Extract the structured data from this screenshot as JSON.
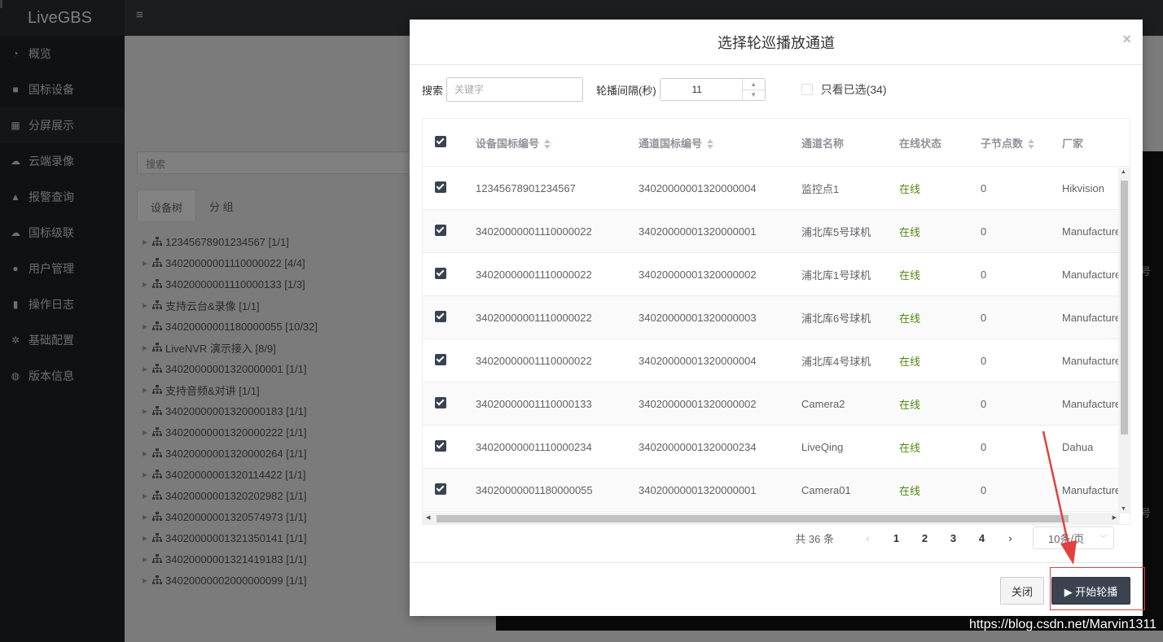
{
  "app": {
    "title": "LiveGBS"
  },
  "sidebar": {
    "items": [
      {
        "label": "概览",
        "icon": "dashboard-icon"
      },
      {
        "label": "国标设备",
        "icon": "video-camera-icon"
      },
      {
        "label": "分屏展示",
        "icon": "grid-icon"
      },
      {
        "label": "云端录像",
        "icon": "cloud-icon"
      },
      {
        "label": "报警查询",
        "icon": "bell-icon"
      },
      {
        "label": "国标级联",
        "icon": "cloud-upload-icon"
      },
      {
        "label": "用户管理",
        "icon": "users-icon"
      },
      {
        "label": "操作日志",
        "icon": "file-icon"
      },
      {
        "label": "基础配置",
        "icon": "gears-icon"
      },
      {
        "label": "版本信息",
        "icon": "globe-icon"
      }
    ]
  },
  "background": {
    "search_placeholder": "搜索",
    "tabs": [
      "设备树",
      "分 组"
    ],
    "tree": [
      "12345678901234567 [1/1]",
      "34020000001110000022 [4/4]",
      "34020000001110000133 [1/3]",
      "支持云台&录像 [1/1]",
      "34020000001180000055 [10/32]",
      "LiveNVR 演示接入 [8/9]",
      "34020000001320000001 [1/1]",
      "支持音频&对讲 [1/1]",
      "34020000001320000183 [1/1]",
      "34020000001320000222 [1/1]",
      "34020000001320000264 [1/1]",
      "34020000001320114422 [1/1]",
      "34020000001320202982 [1/1]",
      "34020000001320574973 [1/1]",
      "34020000001321350141 [1/1]",
      "34020000001321419183 [1/1]",
      "34020000002000000099 [1/1]"
    ],
    "side_label": "号"
  },
  "modal": {
    "title": "选择轮巡播放通道",
    "close_glyph": "×",
    "search_label": "搜索",
    "search_placeholder": "关键字",
    "interval_label": "轮播间隔(秒)",
    "interval_value": "11",
    "only_selected_label": "只看已选(34)",
    "columns": [
      "设备国标编号",
      "通道国标编号",
      "通道名称",
      "在线状态",
      "子节点数",
      "厂家"
    ],
    "rows": [
      {
        "device": "12345678901234567",
        "channel": "34020000001320000004",
        "name": "监控点1",
        "status": "在线",
        "children": "0",
        "vendor": "Hikvision"
      },
      {
        "device": "34020000001110000022",
        "channel": "34020000001320000001",
        "name": "浦北库5号球机",
        "status": "在线",
        "children": "0",
        "vendor": "Manufacturer"
      },
      {
        "device": "34020000001110000022",
        "channel": "34020000001320000002",
        "name": "浦北库1号球机",
        "status": "在线",
        "children": "0",
        "vendor": "Manufacturer"
      },
      {
        "device": "34020000001110000022",
        "channel": "34020000001320000003",
        "name": "浦北库6号球机",
        "status": "在线",
        "children": "0",
        "vendor": "Manufacturer"
      },
      {
        "device": "34020000001110000022",
        "channel": "34020000001320000004",
        "name": "浦北库4号球机",
        "status": "在线",
        "children": "0",
        "vendor": "Manufacturer"
      },
      {
        "device": "34020000001110000133",
        "channel": "34020000001320000002",
        "name": "Camera2",
        "status": "在线",
        "children": "0",
        "vendor": "Manufacturer"
      },
      {
        "device": "34020000001110000234",
        "channel": "34020000001320000234",
        "name": "LiveQing",
        "status": "在线",
        "children": "0",
        "vendor": "Dahua"
      },
      {
        "device": "34020000001180000055",
        "channel": "34020000001320000001",
        "name": "Camera01",
        "status": "在线",
        "children": "0",
        "vendor": "Manufacturer"
      }
    ],
    "pagination": {
      "total": "共 36 条",
      "pages": [
        "1",
        "2",
        "3",
        "4"
      ],
      "page_size": "10条/页"
    },
    "close_button": "关闭",
    "start_button": "▶ 开始轮播"
  },
  "watermark": "https://blog.csdn.net/Marvin1311",
  "colors": {
    "sidebar": "#101113",
    "primary_button": "#3b4350",
    "online": "#4f8a10",
    "annotation": "#e34040"
  }
}
